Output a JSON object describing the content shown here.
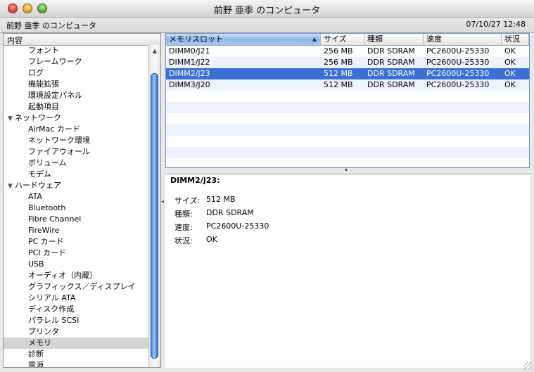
{
  "window": {
    "title": "前野 亜季 のコンピュータ"
  },
  "infobar": {
    "computer_name": "前野 亜季 のコンピュータ",
    "datetime": "07/10/27 12:48"
  },
  "sidebar": {
    "header": "内容",
    "items": [
      {
        "label": "フォント",
        "level": 1
      },
      {
        "label": "フレームワーク",
        "level": 1
      },
      {
        "label": "ログ",
        "level": 1
      },
      {
        "label": "機能拡張",
        "level": 1
      },
      {
        "label": "環境設定パネル",
        "level": 1
      },
      {
        "label": "起動項目",
        "level": 1
      },
      {
        "label": "ネットワーク",
        "level": 0,
        "expanded": true
      },
      {
        "label": "AirMac カード",
        "level": 1
      },
      {
        "label": "ネットワーク環境",
        "level": 1
      },
      {
        "label": "ファイアウォール",
        "level": 1
      },
      {
        "label": "ボリューム",
        "level": 1
      },
      {
        "label": "モデム",
        "level": 1
      },
      {
        "label": "ハードウェア",
        "level": 0,
        "expanded": true
      },
      {
        "label": "ATA",
        "level": 1
      },
      {
        "label": "Bluetooth",
        "level": 1
      },
      {
        "label": "Fibre Channel",
        "level": 1
      },
      {
        "label": "FireWire",
        "level": 1
      },
      {
        "label": "PC カード",
        "level": 1
      },
      {
        "label": "PCI カード",
        "level": 1
      },
      {
        "label": "USB",
        "level": 1
      },
      {
        "label": "オーディオ（内蔵）",
        "level": 1
      },
      {
        "label": "グラフィックス／ディスプレイ",
        "level": 1
      },
      {
        "label": "シリアル ATA",
        "level": 1
      },
      {
        "label": "ディスク作成",
        "level": 1
      },
      {
        "label": "パラレル SCSI",
        "level": 1
      },
      {
        "label": "プリンタ",
        "level": 1
      },
      {
        "label": "メモリ",
        "level": 1,
        "selected": true
      },
      {
        "label": "診断",
        "level": 1
      },
      {
        "label": "電源",
        "level": 1
      }
    ]
  },
  "table": {
    "columns": [
      "メモリスロット",
      "サイズ",
      "種類",
      "速度",
      "状況"
    ],
    "rows": [
      [
        "DIMM0/J21",
        "256 MB",
        "DDR SDRAM",
        "PC2600U-25330",
        "OK"
      ],
      [
        "DIMM1/J22",
        "256 MB",
        "DDR SDRAM",
        "PC2600U-25330",
        "OK"
      ],
      [
        "DIMM2/J23",
        "512 MB",
        "DDR SDRAM",
        "PC2600U-25330",
        "OK"
      ],
      [
        "DIMM3/J20",
        "512 MB",
        "DDR SDRAM",
        "PC2600U-25330",
        "OK"
      ]
    ],
    "selected_row": 2
  },
  "detail": {
    "title": "DIMM2/J23:",
    "fields": [
      {
        "key": "サイズ:",
        "value": "512 MB"
      },
      {
        "key": "種類:",
        "value": "DDR SDRAM"
      },
      {
        "key": "速度:",
        "value": "PC2600U-25330"
      },
      {
        "key": "状況:",
        "value": "OK"
      }
    ]
  },
  "colors": {
    "selection": "#3a6fd3",
    "alt_row": "#edf3fe",
    "sidebar_selection": "#d4d4d4"
  }
}
